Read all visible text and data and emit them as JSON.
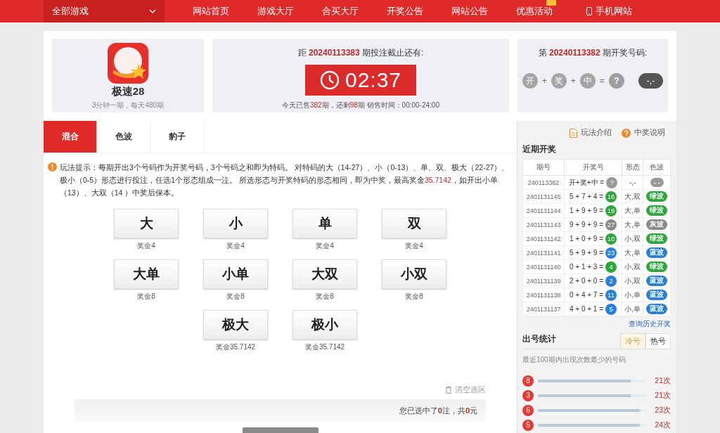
{
  "nav": {
    "game_select": "全部游戏",
    "items": [
      "网站首页",
      "游戏大厅",
      "合买大厅",
      "开奖公告",
      "网站公告",
      "优惠活动"
    ],
    "mobile": "手机网站"
  },
  "lottery": {
    "name": "极速28",
    "subtitle": "3分钟一期，每天480期"
  },
  "countdown": {
    "prefix": "距",
    "issue": "20240113383",
    "suffix": "期投注截止还有:",
    "time": "02:37",
    "sales": [
      {
        "kind": "plain",
        "text": "今天已售"
      },
      {
        "kind": "num",
        "text": "382"
      },
      {
        "kind": "plain",
        "text": "期，还剩"
      },
      {
        "kind": "num",
        "text": "98"
      },
      {
        "kind": "plain",
        "text": "期 销售时间：00:00-24:00"
      }
    ]
  },
  "last_draw": {
    "prefix": "第",
    "issue": "20240113382",
    "suffix": "期开奖号码:",
    "tokens": [
      {
        "kind": "ball",
        "text": "开"
      },
      {
        "kind": "op",
        "text": "+"
      },
      {
        "kind": "ball",
        "text": "奖"
      },
      {
        "kind": "op",
        "text": "+"
      },
      {
        "kind": "ball",
        "text": "中"
      },
      {
        "kind": "op",
        "text": "="
      },
      {
        "kind": "unknown",
        "text": "?"
      },
      {
        "kind": "pill",
        "text": "-,-"
      }
    ]
  },
  "tabs": [
    {
      "label": "混合",
      "selected": true
    },
    {
      "label": "色波",
      "selected": false
    },
    {
      "label": "豹子",
      "selected": false
    }
  ],
  "hint": [
    {
      "kind": "plain",
      "text": "玩法提示：每期开出3个号码作为开奖号码，3个号码之和即为特码。 对特码的大（14-27）、小（0-13）、单、双、极大（22-27）、极小（0-5）形态进行投注，任选1个形态组成一注。 所选形态与开奖特码的形态相同，即为中奖，最高奖金"
    },
    {
      "kind": "num",
      "text": "35.7142"
    },
    {
      "kind": "plain",
      "text": "，如开出小单（13）、大双（14 ）中奖后保本。"
    }
  ],
  "bet_rows": [
    [
      {
        "label": "大",
        "prize": "奖金4"
      },
      {
        "label": "小",
        "prize": "奖金4"
      },
      {
        "label": "单",
        "prize": "奖金4"
      },
      {
        "label": "双",
        "prize": "奖金4"
      }
    ],
    [
      {
        "label": "大单",
        "prize": "奖金8"
      },
      {
        "label": "小单",
        "prize": "奖金8"
      },
      {
        "label": "大双",
        "prize": "奖金8"
      },
      {
        "label": "小双",
        "prize": "奖金8"
      }
    ],
    [
      {
        "label": "极大",
        "prize": "奖金35.7142"
      },
      {
        "label": "极小",
        "prize": "奖金35.7142"
      }
    ]
  ],
  "clear": "清空选区",
  "summary": "您已选中了**0**注，共**0**元",
  "side_links": [
    {
      "kind": "doc",
      "label": "玩法介绍"
    },
    {
      "kind": "help",
      "label": "中奖说明"
    }
  ],
  "recent": {
    "title": "近期开奖",
    "columns": [
      "期号",
      "开奖号",
      "形态",
      "色波"
    ],
    "rows": [
      {
        "issue": "240113382",
        "expr": "开+奖+中 =",
        "sum": "?",
        "shape": "-,-",
        "wave": "- -",
        "color": "#999999"
      },
      {
        "issue": "2401131145",
        "expr": "5 + 7 + 4 =",
        "sum": "16",
        "shape": "大,双",
        "wave": "绿波",
        "color": "#2aa83a"
      },
      {
        "issue": "2401131144",
        "expr": "1 + 9 + 9 =",
        "sum": "19",
        "shape": "大,单",
        "wave": "绿波",
        "color": "#2aa83a"
      },
      {
        "issue": "2401131143",
        "expr": "9 + 9 + 9 =",
        "sum": "27",
        "shape": "大,单",
        "wave": "灰波",
        "color": "#8a8a8a"
      },
      {
        "issue": "2401131142",
        "expr": "1 + 0 + 9 =",
        "sum": "10",
        "shape": "小,双",
        "wave": "绿波",
        "color": "#2aa83a"
      },
      {
        "issue": "2401131141",
        "expr": "5 + 9 + 9 =",
        "sum": "23",
        "shape": "大,单",
        "wave": "蓝波",
        "color": "#2a7fd6"
      },
      {
        "issue": "2401131140",
        "expr": "0 + 1 + 3 =",
        "sum": "4",
        "shape": "小,双",
        "wave": "绿波",
        "color": "#2aa83a"
      },
      {
        "issue": "2401131139",
        "expr": "2 + 0 + 0 =",
        "sum": "2",
        "shape": "小,双",
        "wave": "蓝波",
        "color": "#2a7fd6"
      },
      {
        "issue": "2401131138",
        "expr": "0 + 4 + 7 =",
        "sum": "11",
        "shape": "小,单",
        "wave": "蓝波",
        "color": "#2a7fd6"
      },
      {
        "issue": "2401131137",
        "expr": "4 + 0 + 1 =",
        "sum": "5",
        "shape": "小,单",
        "wave": "蓝波",
        "color": "#2a7fd6"
      }
    ],
    "more": "查询历史开奖"
  },
  "stats": {
    "title": "出号统计",
    "tabs": [
      {
        "label": "冷号",
        "selected": true
      },
      {
        "label": "热号",
        "selected": false
      }
    ],
    "desc": "最近100期内出现次数最少的号码",
    "items": [
      {
        "ball": "8",
        "level": 0.86,
        "count": "21次"
      },
      {
        "ball": "3",
        "level": 0.86,
        "count": "21次"
      },
      {
        "ball": "6",
        "level": 0.95,
        "count": "23次"
      },
      {
        "ball": "5",
        "level": 0.95,
        "count": "24次"
      }
    ]
  }
}
